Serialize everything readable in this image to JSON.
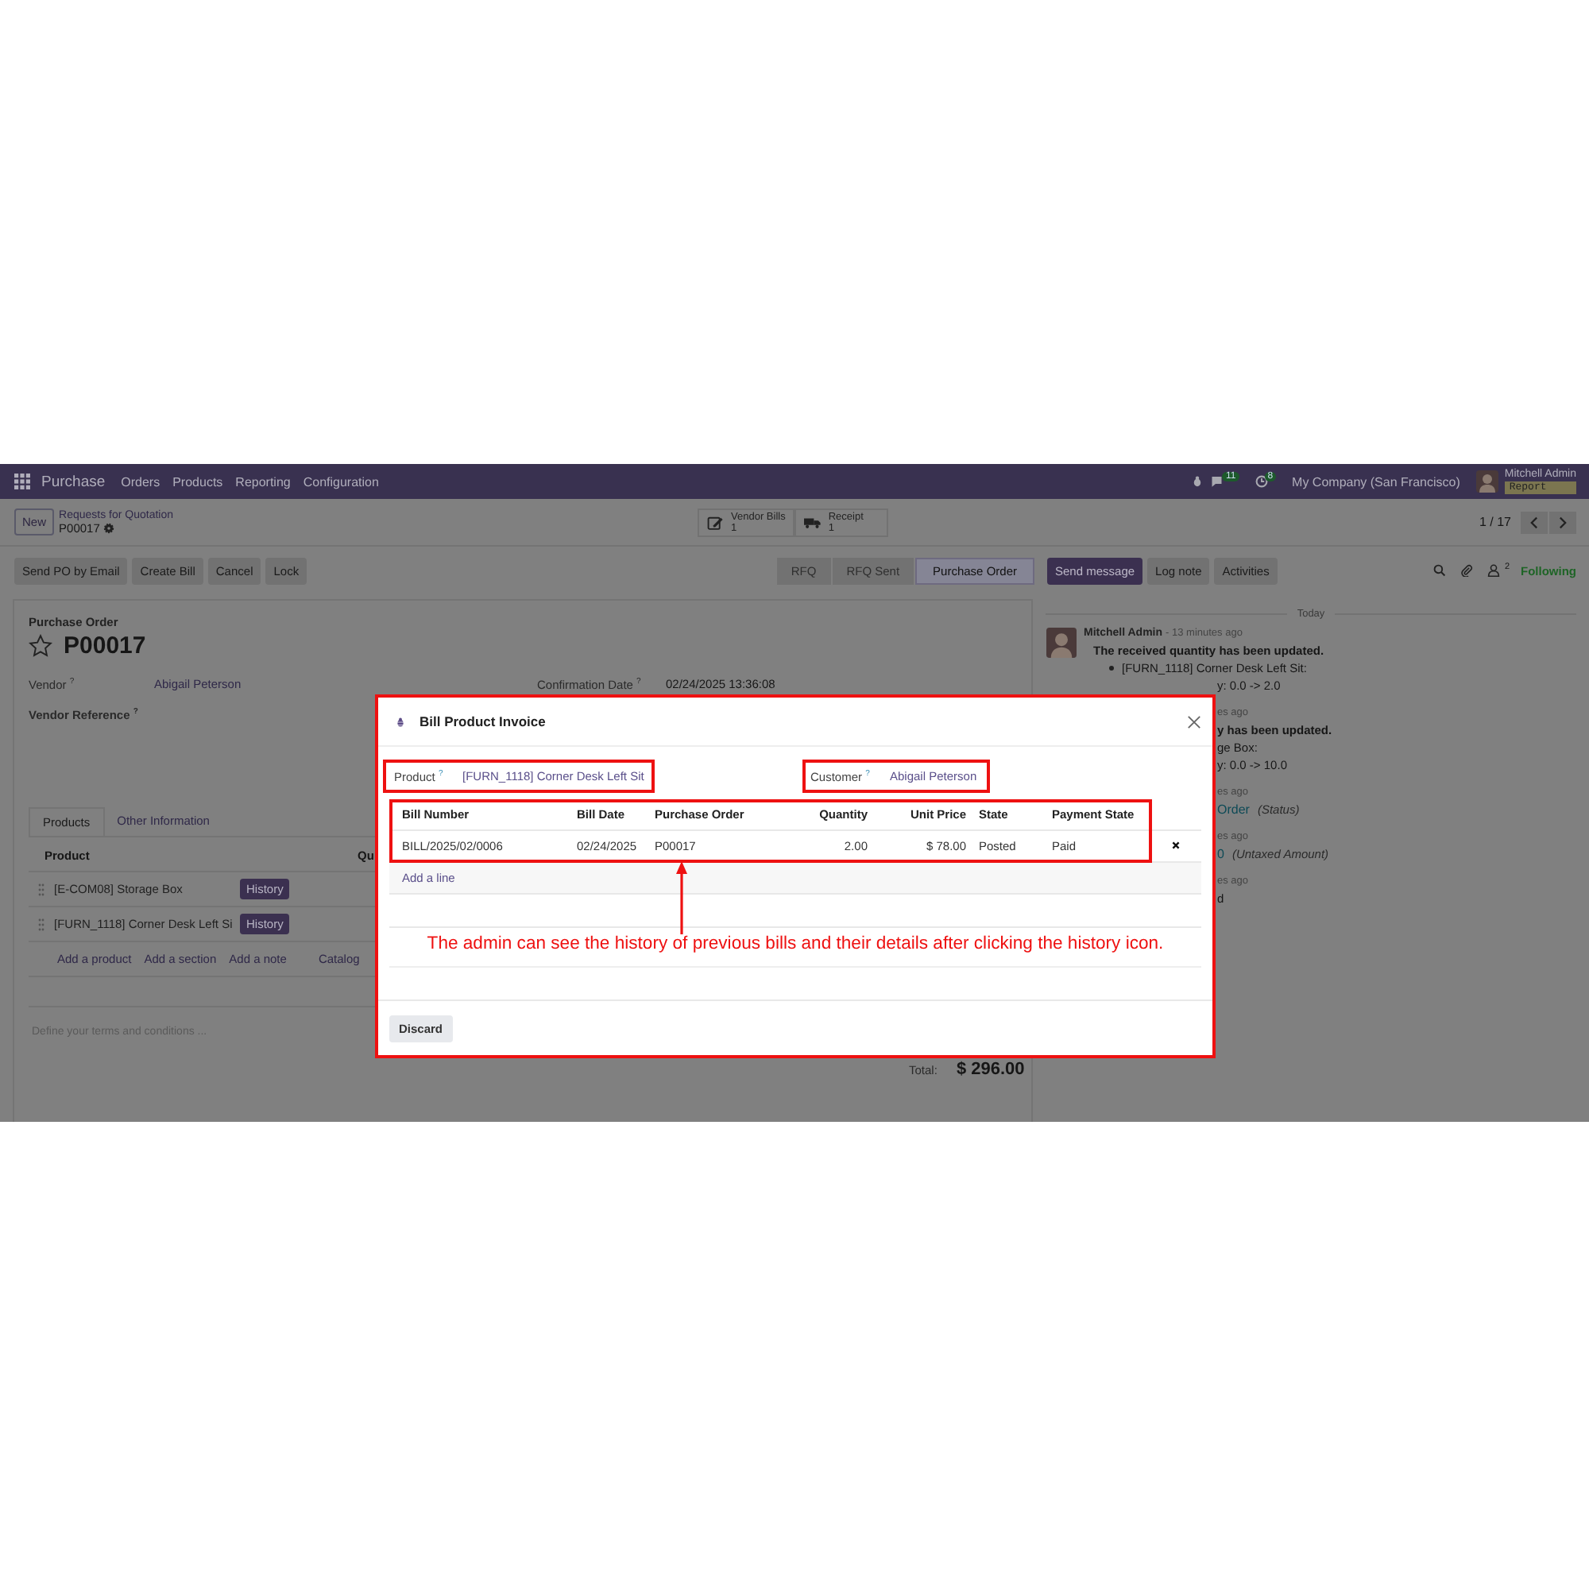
{
  "navbar": {
    "app_name": "Purchase",
    "menu": [
      "Orders",
      "Products",
      "Reporting",
      "Configuration"
    ],
    "messages_count": "11",
    "activities_count": "8",
    "company": "My Company (San Francisco)",
    "user_name": "Mitchell Admin",
    "user_tag": "Report"
  },
  "control_panel": {
    "new_button": "New",
    "breadcrumb_parent": "Requests for Quotation",
    "record_name": "P00017",
    "smart_buttons": [
      {
        "kind": "bills",
        "label": "Vendor Bills",
        "count": "1"
      },
      {
        "kind": "receipt",
        "label": "Receipt",
        "count": "1"
      }
    ],
    "pager": "1 / 17"
  },
  "action_buttons": [
    "Send PO by Email",
    "Create Bill",
    "Cancel",
    "Lock"
  ],
  "status_steps": [
    {
      "label": "RFQ",
      "selected": false
    },
    {
      "label": "RFQ Sent",
      "selected": false
    },
    {
      "label": "Purchase Order",
      "selected": true
    }
  ],
  "chatter_buttons": [
    {
      "label": "Send message",
      "selected": true
    },
    {
      "label": "Log note",
      "selected": false
    },
    {
      "label": "Activities",
      "selected": false
    }
  ],
  "followers_count": "2",
  "following": "Following",
  "form": {
    "title_label": "Purchase Order",
    "name": "P00017",
    "vendor_label": "Vendor $^{?}$",
    "vendor": "Abigail Peterson",
    "confirmation_label": "Confirmation Date $^{?}$",
    "confirmation_date": "02/24/2025 13:36:08",
    "vendor_ref_label": "Vendor Reference $^{?}$",
    "tabs": [
      {
        "label": "Products",
        "selected": true
      },
      {
        "label": "Other Information",
        "selected": false
      }
    ],
    "column_product": "Product",
    "column_2": "Qu",
    "lines": [
      {
        "product": "[E-COM08] Storage Box",
        "button": "History"
      },
      {
        "product": "[FURN_1118] Corner Desk Left Si",
        "button": "History"
      }
    ],
    "add_links": [
      "Add a product",
      "Add a section",
      "Add a note",
      "Catalog"
    ],
    "terms_placeholder": "Define your terms and conditions ...",
    "total_label": "Total:",
    "total": "$ 296.00"
  },
  "chatter": {
    "date_label": "Today",
    "author": "Mitchell Admin",
    "time": "- 13 minutes ago",
    "message_title": "The received quantity has been updated.",
    "bullet": "[FURN_1118] Corner Desk Left Sit:",
    "fragments": [
      [
        {
          "kind": "plain",
          "text": "y: 0.0 -> 2.0"
        }
      ],
      [
        {
          "kind": "time",
          "text": "es ago"
        }
      ],
      [
        {
          "kind": "bold",
          "text": "y has been updated."
        }
      ],
      [
        {
          "kind": "plain",
          "text": "ge Box:"
        }
      ],
      [
        {
          "kind": "plain",
          "text": "y: 0.0 -> 10.0"
        }
      ],
      [
        {
          "kind": "time",
          "text": "es ago"
        }
      ],
      [
        {
          "kind": "link",
          "text": "Order"
        },
        {
          "kind": "note",
          "text": "(Status)"
        }
      ],
      [
        {
          "kind": "time",
          "text": "es ago"
        }
      ],
      [
        {
          "kind": "link",
          "text": "0"
        },
        {
          "kind": "note",
          "text": "(Untaxed Amount)"
        }
      ],
      [
        {
          "kind": "time",
          "text": "es ago"
        }
      ],
      [
        {
          "kind": "plain",
          "text": "d"
        }
      ]
    ]
  },
  "modal": {
    "title": "Bill Product Invoice",
    "product_label": "Product $^{?}$",
    "product": "[FURN_1118] Corner Desk Left Sit",
    "customer_label": "Customer $^{?}$",
    "customer": "Abigail Peterson",
    "columns": [
      "Bill Number",
      "Bill Date",
      "Purchase Order",
      "Quantity",
      "Unit Price",
      "State",
      "Payment State"
    ],
    "rows": [
      [
        "BILL/2025/02/0006",
        "02/24/2025",
        "P00017",
        "2.00",
        "$ 78.00",
        "Posted",
        "Paid"
      ]
    ],
    "add_line": "Add a line",
    "discard": "Discard"
  },
  "annotation": {
    "text": "The admin can see the history of previous bills and their details after clicking the history icon."
  }
}
